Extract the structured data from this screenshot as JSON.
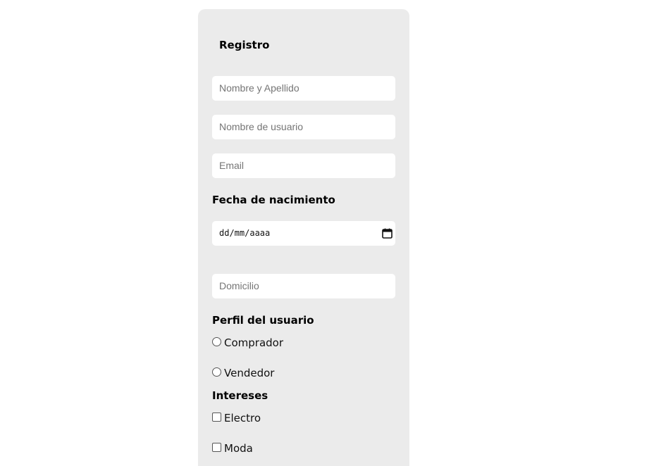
{
  "form": {
    "title": "Registro",
    "fields": {
      "full_name_placeholder": "Nombre y Apellido",
      "username_placeholder": "Nombre de usuario",
      "email_placeholder": "Email",
      "address_placeholder": "Domicilio"
    },
    "birth_date": {
      "label": "Fecha de nacimiento",
      "format_text": "dd/mm/aaaa"
    },
    "profile": {
      "label": "Perfil del usuario",
      "options": [
        "Comprador",
        "Vendedor"
      ]
    },
    "interests": {
      "label": "Intereses",
      "options": [
        "Electro",
        "Moda"
      ]
    }
  },
  "icons": {
    "date_picker": "calendar-icon"
  },
  "colors": {
    "card_background": "#ebebeb",
    "field_background": "#ffffff",
    "placeholder_text": "#757575"
  }
}
